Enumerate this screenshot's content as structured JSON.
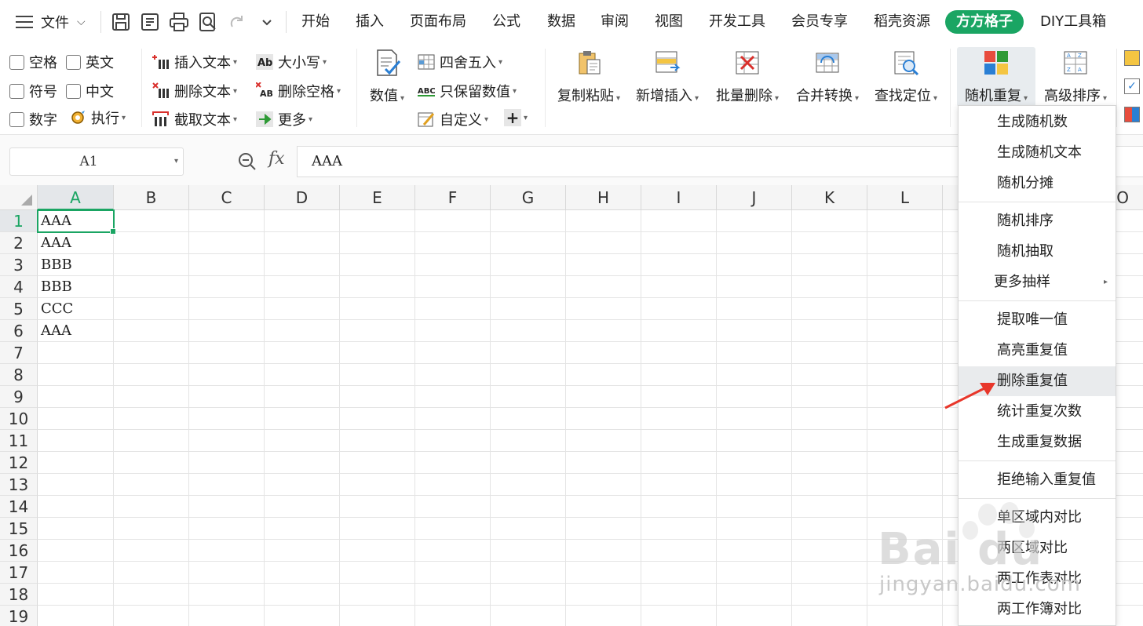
{
  "titlebar": {
    "file_menu": "文件",
    "tabs": [
      "开始",
      "插入",
      "页面布局",
      "公式",
      "数据",
      "审阅",
      "视图",
      "开发工具",
      "会员专享",
      "稻壳资源",
      "方方格子",
      "DIY工具箱"
    ],
    "active_tab_index": 10,
    "accent_color": "#1aa563"
  },
  "ribbon": {
    "checkboxes": [
      "空格",
      "英文",
      "符号",
      "中文",
      "数字"
    ],
    "execute": "执行",
    "text_group": [
      "插入文本",
      "删除文本",
      "截取文本"
    ],
    "case_group": [
      "大小写",
      "删除空格",
      "更多"
    ],
    "numeric_big": "数值",
    "numeric_group": [
      "四舍五入",
      "只保留数值",
      "自定义"
    ],
    "big_buttons": [
      "复制粘贴",
      "新增插入",
      "批量删除",
      "合并转换",
      "查找定位",
      "随机重复",
      "高级排序"
    ]
  },
  "formula_bar": {
    "name_box": "A1",
    "fx": "fx",
    "content": "AAA"
  },
  "sheet": {
    "columns": [
      "A",
      "B",
      "C",
      "D",
      "E",
      "F",
      "G",
      "H",
      "I",
      "J",
      "K",
      "L",
      "O"
    ],
    "rows": [
      "1",
      "2",
      "3",
      "4",
      "5",
      "6",
      "7",
      "8",
      "9",
      "10",
      "11",
      "12",
      "13",
      "14",
      "15",
      "16",
      "17",
      "18",
      "19"
    ],
    "cells_A": [
      "AAA",
      "AAA",
      "BBB",
      "BBB",
      "CCC",
      "AAA"
    ],
    "selected_cell": "A1"
  },
  "menu": {
    "items": [
      "生成随机数",
      "生成随机文本",
      "随机分摊",
      "随机排序",
      "随机抽取",
      "更多抽样",
      "提取唯一值",
      "高亮重复值",
      "删除重复值",
      "统计重复次数",
      "生成重复数据",
      "拒绝输入重复值",
      "单区域内对比",
      "两区域对比",
      "两工作表对比",
      "两工作簿对比"
    ],
    "highlighted": "删除重复值"
  },
  "watermark": {
    "logo": "Bai du",
    "url": "jingyan.baidu.com"
  }
}
